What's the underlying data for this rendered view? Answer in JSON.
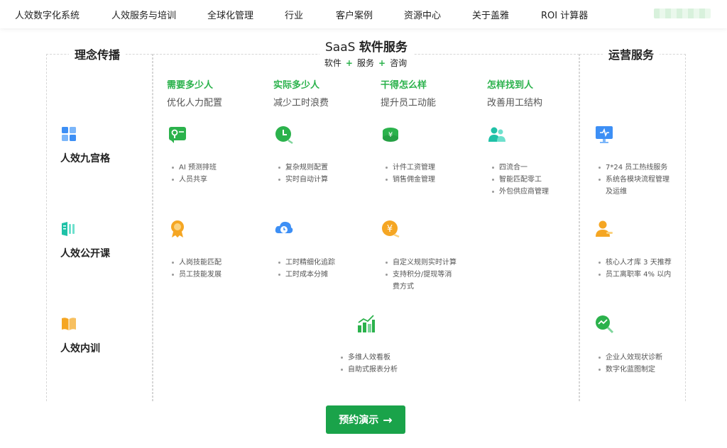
{
  "nav": {
    "items": [
      "人效数字化系统",
      "人效服务与培训",
      "全球化管理",
      "行业",
      "客户案例",
      "资源中心",
      "关于盖雅",
      "ROI 计算器"
    ]
  },
  "left": {
    "title": "理念传播",
    "pillars": [
      "人效九宫格",
      "人效公开课",
      "人效内训"
    ]
  },
  "middle": {
    "title_latin": "SaaS",
    "title_rest": "软件服务",
    "sub": [
      "软件",
      "服务",
      "咨询"
    ],
    "questions": [
      {
        "h": "需要多少人",
        "s": "优化人力配置"
      },
      {
        "h": "实际多少人",
        "s": "减少工时浪费"
      },
      {
        "h": "干得怎么样",
        "s": "提升员工动能"
      },
      {
        "h": "怎样找到人",
        "s": "改善用工结构"
      }
    ],
    "row1": [
      [
        "AI 预测排班",
        "人员共享"
      ],
      [
        "复杂规则配置",
        "实时自动计算"
      ],
      [
        "计件工资管理",
        "销售佣金管理"
      ],
      [
        "四流合一",
        "智能匹配零工",
        "外包供应商管理"
      ]
    ],
    "row2": [
      [
        "人岗技能匹配",
        "员工技能发展"
      ],
      [
        "工时精细化追踪",
        "工时成本分摊"
      ],
      [
        "自定义规则实时计算",
        "支持积分/提现等消",
        "费方式"
      ]
    ],
    "row3": [
      "多维人效看板",
      "自助式报表分析"
    ]
  },
  "right": {
    "title": "运营服务",
    "row1": [
      "7*24 员工热线服务",
      "系统各模块流程管理",
      "及运维"
    ],
    "row2": [
      "核心人才库 3 天推荐",
      "员工离职率 4% 以内"
    ],
    "row3": [
      "企业人效现状诊断",
      "数字化蓝图制定"
    ]
  },
  "cta": {
    "label": "预约演示"
  },
  "colors": {
    "green": "#2bb24c",
    "cta": "#1aa34a",
    "blue": "#3d8ff5",
    "orange": "#f5a623",
    "teal": "#1fc1a7"
  }
}
